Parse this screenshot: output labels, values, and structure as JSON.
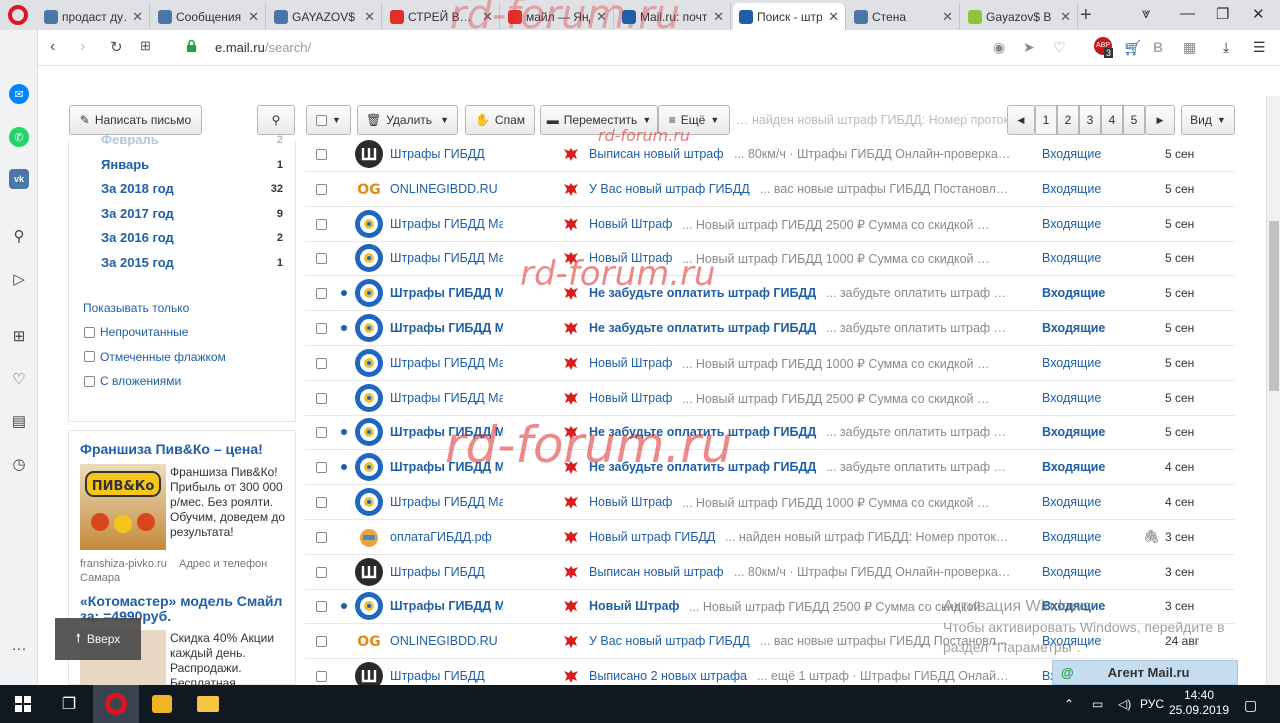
{
  "browser": {
    "tabs": [
      {
        "title": "продаст ду…",
        "color": "#4a76a8",
        "active": false
      },
      {
        "title": "Сообщения",
        "color": "#4a76a8",
        "active": false
      },
      {
        "title": "GAYAZOV$ В",
        "color": "#4a76a8",
        "active": false
      },
      {
        "title": "СТРЕЙ В…",
        "color": "#e52d27",
        "active": false
      },
      {
        "title": "майл — Янд",
        "color": "#e52d27",
        "active": false
      },
      {
        "title": "Mail.ru: почт",
        "color": "#1f5fa6",
        "active": false
      },
      {
        "title": "Поиск - штр",
        "color": "#1f5fa6",
        "active": true
      },
      {
        "title": "Стена",
        "color": "#4a76a8",
        "active": false
      },
      {
        "title": "Gayazov$ В",
        "color": "#8cc63f",
        "active": false
      }
    ],
    "new_tab": "+",
    "url_host": "e.mail.ru",
    "url_path": "/search/",
    "abp_badge": "3"
  },
  "toolbar": {
    "compose": "Написать письмо",
    "delete": "Удалить",
    "spam": "Спам",
    "move": "Переместить",
    "more": "Ещё",
    "view": "Вид",
    "pages": [
      "1",
      "2",
      "3",
      "4",
      "5"
    ]
  },
  "folders": [
    {
      "name": "Февраль",
      "count": "2"
    },
    {
      "name": "Январь",
      "count": "1"
    },
    {
      "name": "За 2018 год",
      "count": "32"
    },
    {
      "name": "За 2017 год",
      "count": "9"
    },
    {
      "name": "За 2016 год",
      "count": "2"
    },
    {
      "name": "За 2015 год",
      "count": "1"
    }
  ],
  "filters": {
    "title": "Показывать только",
    "items": [
      "Непрочитанные",
      "Отмеченные флажком",
      "С вложениями"
    ]
  },
  "ads": [
    {
      "title": "Франшиза Пив&Ко – цена!",
      "text": "Франшиза Пив&Ко! Прибыль от 300 000 р/мес. Без роялти. Обучим, доведем до результата!",
      "domain": "franshiza-pivko.ru",
      "address": "Адрес и телефон",
      "city": "Самара"
    },
    {
      "title": "«Котомастер» модель Смайл за: =4990руб.",
      "text": "Скидка 40% Акции каждый день. Распродажи. Бесплатная"
    }
  ],
  "up_button": "Вверх",
  "emails": [
    {
      "sender": "Штрафы ГИБДД",
      "avatar": "dark",
      "subject": "Выписан новый штраф",
      "snippet": "... 80км/ч · Штрафы ГИБДД Онлайн-проверка…",
      "folder": "Входящие",
      "date": "5 сен",
      "unread": false,
      "attach": false
    },
    {
      "sender": "ONLINEGIBDD.RU",
      "avatar": "og",
      "subject": "У Вас новый штраф ГИБДД",
      "snippet": "... вас новые штрафы ГИБДД Постановл…",
      "folder": "Входящие",
      "date": "5 сен",
      "unread": false,
      "attach": false
    },
    {
      "sender": "Штрафы ГИБДД Ма",
      "avatar": "blue",
      "subject": "Новый Штраф",
      "snippet": "... Новый штраф ГИБДД 2500 ₽ Сумма со скидкой …",
      "folder": "Входящие",
      "date": "5 сен",
      "unread": false,
      "attach": false
    },
    {
      "sender": "Штрафы ГИБДД Ма",
      "avatar": "blue",
      "subject": "Новый Штраф",
      "snippet": "... Новый штраф ГИБДД 1000 ₽ Сумма со скидкой …",
      "folder": "Входящие",
      "date": "5 сен",
      "unread": false,
      "attach": false
    },
    {
      "sender": "Штрафы ГИБДД М",
      "avatar": "blue",
      "subject": "Не забудьте оплатить штраф ГИБДД",
      "snippet": "... забудьте оплатить штраф …",
      "folder": "Входящие",
      "date": "5 сен",
      "unread": true,
      "attach": false
    },
    {
      "sender": "Штрафы ГИБДД М",
      "avatar": "blue",
      "subject": "Не забудьте оплатить штраф ГИБДД",
      "snippet": "... забудьте оплатить штраф …",
      "folder": "Входящие",
      "date": "5 сен",
      "unread": true,
      "attach": false
    },
    {
      "sender": "Штрафы ГИБДД Ма",
      "avatar": "blue",
      "subject": "Новый Штраф",
      "snippet": "... Новый штраф ГИБДД 1000 ₽ Сумма со скидкой …",
      "folder": "Входящие",
      "date": "5 сен",
      "unread": false,
      "attach": false
    },
    {
      "sender": "Штрафы ГИБДД Ма",
      "avatar": "blue",
      "subject": "Новый Штраф",
      "snippet": "... Новый штраф ГИБДД 2500 ₽ Сумма со скидкой …",
      "folder": "Входящие",
      "date": "5 сен",
      "unread": false,
      "attach": false
    },
    {
      "sender": "Штрафы ГИБДД М",
      "avatar": "blue",
      "subject": "Не забудьте оплатить штраф ГИБДД",
      "snippet": "... забудьте оплатить штраф …",
      "folder": "Входящие",
      "date": "5 сен",
      "unread": true,
      "attach": false
    },
    {
      "sender": "Штрафы ГИБДД М",
      "avatar": "blue",
      "subject": "Не забудьте оплатить штраф ГИБДД",
      "snippet": "... забудьте оплатить штраф …",
      "folder": "Входящие",
      "date": "4 сен",
      "unread": true,
      "attach": false
    },
    {
      "sender": "Штрафы ГИБДД Ма",
      "avatar": "blue",
      "subject": "Новый Штраф",
      "snippet": "... Новый штраф ГИБДД 1000 ₽ Сумма со скидкой …",
      "folder": "Входящие",
      "date": "4 сен",
      "unread": false,
      "attach": false
    },
    {
      "sender": "оплатаГИБДД.рф",
      "avatar": "orange",
      "subject": "Новый штраф ГИБДД",
      "snippet": "... найден новый штраф ГИБДД: Номер проток…",
      "folder": "Входящие",
      "date": "3 сен",
      "unread": false,
      "attach": true
    },
    {
      "sender": "Штрафы ГИБДД",
      "avatar": "dark",
      "subject": "Выписан новый штраф",
      "snippet": "... 80км/ч · Штрафы ГИБДД Онлайн-проверка…",
      "folder": "Входящие",
      "date": "3 сен",
      "unread": false,
      "attach": false
    },
    {
      "sender": "Штрафы ГИБДД М",
      "avatar": "blue",
      "subject": "Новый Штраф",
      "snippet": "... Новый штраф ГИБДД 2500 ₽ Сумма со скидкой …",
      "folder": "Входящие",
      "date": "3 сен",
      "unread": true,
      "attach": false
    },
    {
      "sender": "ONLINEGIBDD.RU",
      "avatar": "og",
      "subject": "У Вас новый штраф ГИБДД",
      "snippet": "... вас новые штрафы ГИБДД Постановл…",
      "folder": "Входящие",
      "date": "24 авг",
      "unread": false,
      "attach": false
    },
    {
      "sender": "Штрафы ГИБДД",
      "avatar": "dark",
      "subject": "Выписано 2 новых штрафа",
      "snippet": "... ещё 1 штраф · Штрафы ГИБДД Онлай…",
      "folder": "Входящие",
      "date": "",
      "unread": false,
      "attach": false
    }
  ],
  "header_snippet": "… найден новый штраф ГИБДД: Номер проток…",
  "watermarks": [
    "rd-forum.ru",
    "rd-forum.ru",
    "rd-forum.ru",
    "rd-forum.ru"
  ],
  "activation": {
    "title": "Активация Windows",
    "line1": "Чтобы активировать Windows, перейдите в",
    "line2": "раздел \"Параметры\"."
  },
  "agent": {
    "label": "Агент Mail.ru"
  },
  "taskbar": {
    "lang": "РУС",
    "time": "14:40",
    "date": "25.09.2019"
  }
}
